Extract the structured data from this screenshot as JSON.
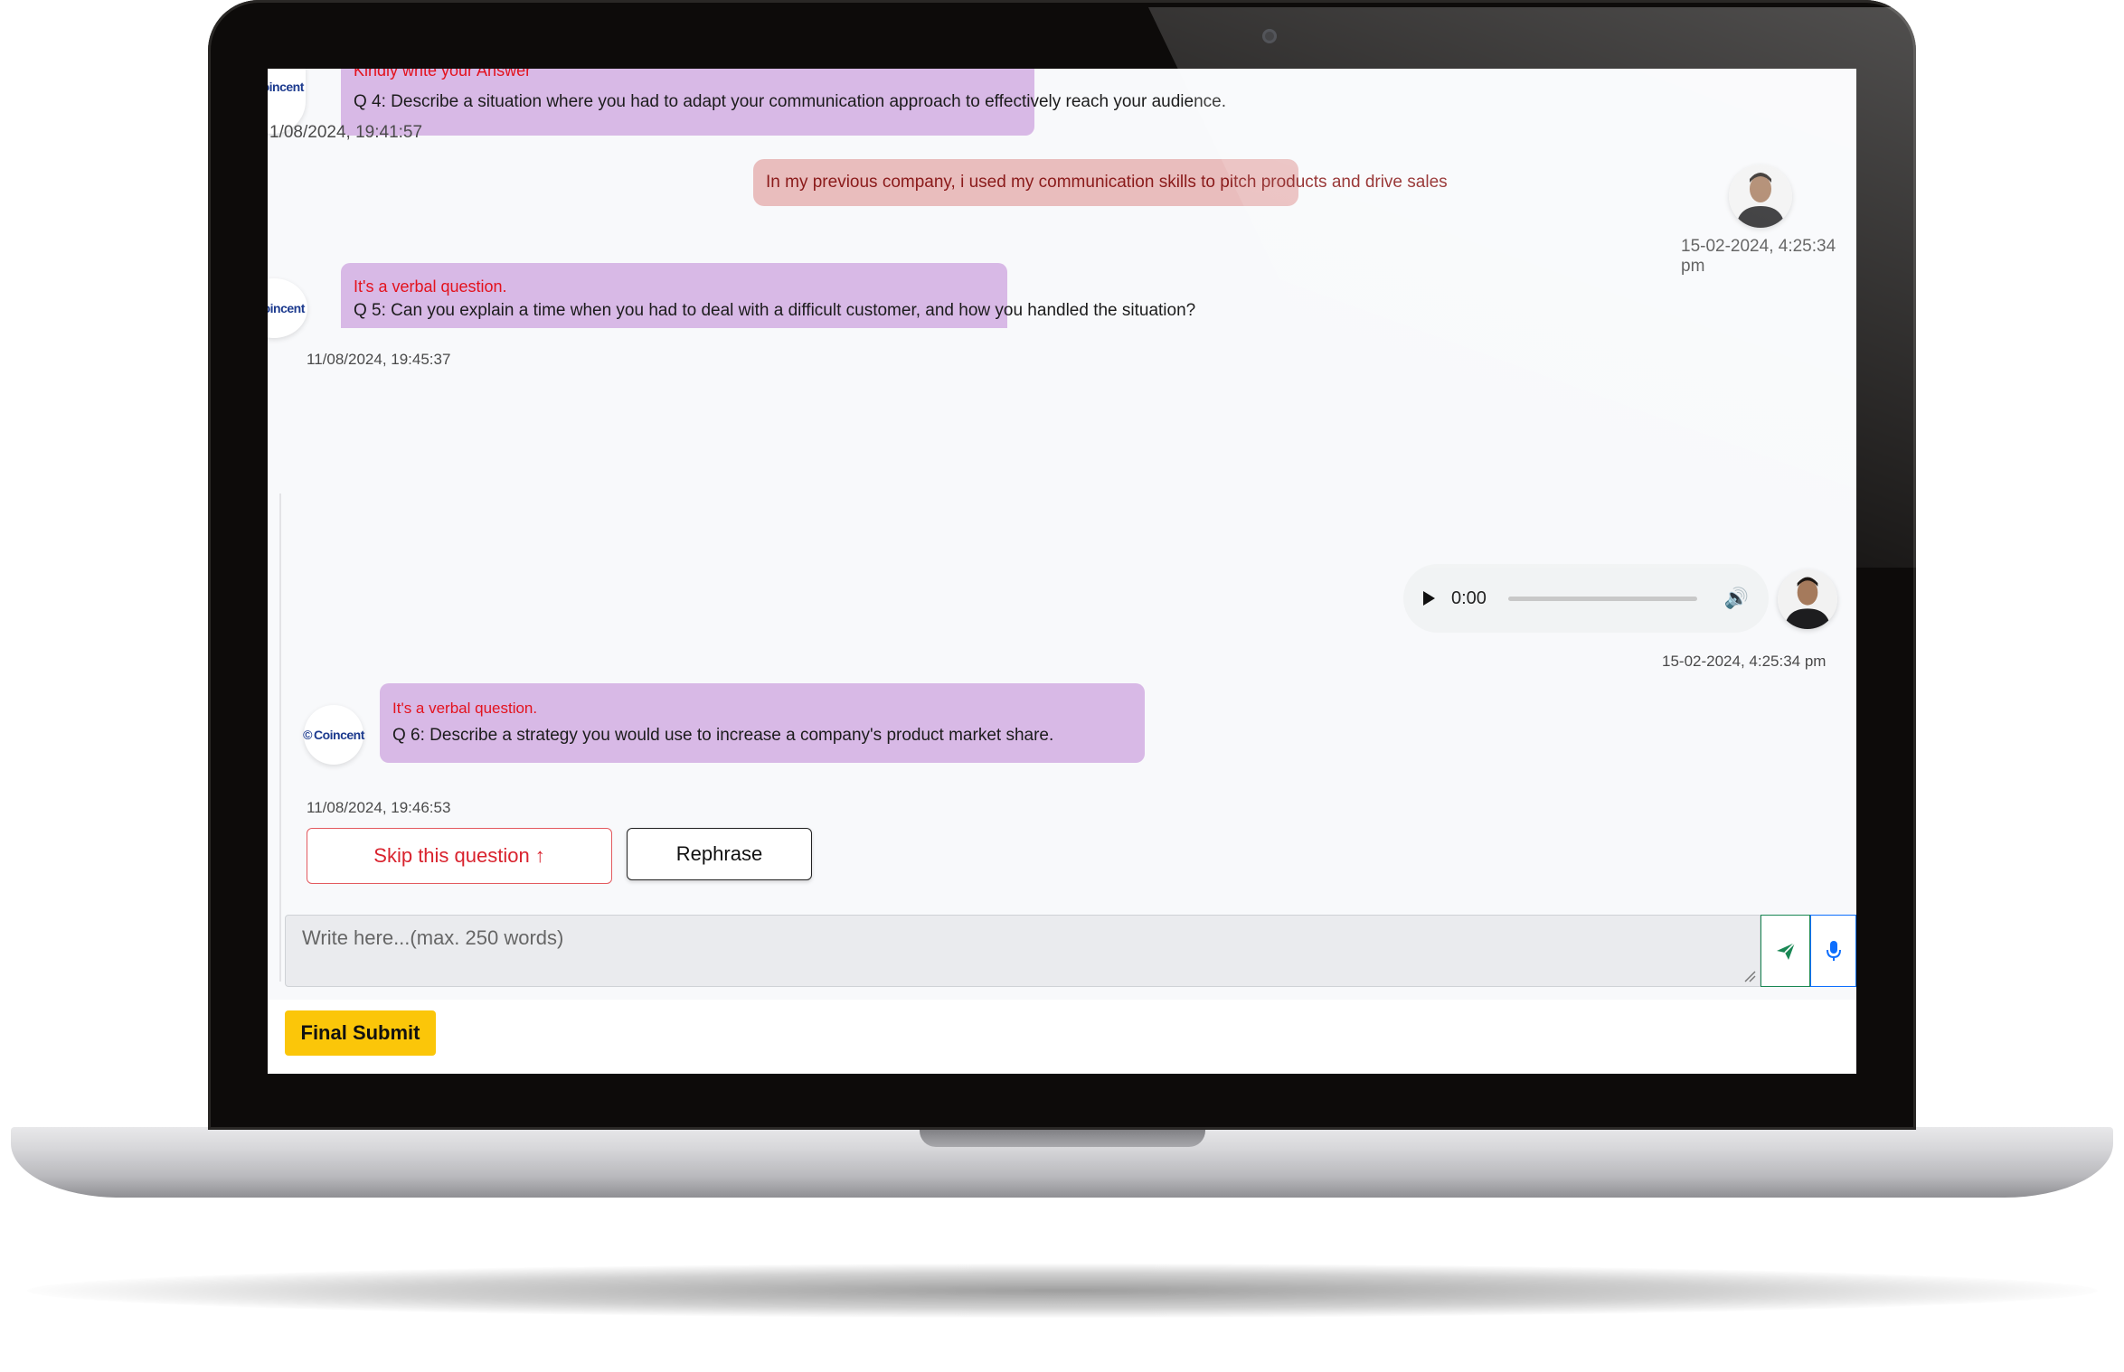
{
  "brand": {
    "logo_text": "Coincent"
  },
  "chat": {
    "q4": {
      "hint": "Kindly write your Answer",
      "text": "Q 4: Describe a situation where you had to adapt your communication approach to effectively reach your audience.",
      "timestamp": "1/08/2024, 19:41:57"
    },
    "a4": {
      "text": "In my previous company, i used my communication skills to pitch products and drive sales",
      "timestamp": "15-02-2024, 4:25:34 pm"
    },
    "q5": {
      "hint": "It's a verbal question.",
      "text": "Q 5: Can you explain a time when you had to deal with a difficult customer, and how you handled the situation?",
      "timestamp": "11/08/2024, 19:45:37"
    },
    "a5": {
      "audio_time": "0:00",
      "timestamp": "15-02-2024, 4:25:34 pm"
    },
    "q6": {
      "hint": "It's a verbal question.",
      "text": "Q 6: Describe a strategy you would use to increase a company's product market share.",
      "timestamp": "11/08/2024, 19:46:53"
    }
  },
  "actions": {
    "skip_label": "Skip this question",
    "skip_icon": "↑",
    "rephrase_label": "Rephrase"
  },
  "composer": {
    "placeholder": "Write here...(max. 250 words)",
    "send_icon": "send-icon",
    "mic_icon": "mic-icon"
  },
  "footer": {
    "final_submit_label": "Final Submit"
  },
  "colors": {
    "question_bubble": "#d8b9e6",
    "answer_bubble": "#e9bdbd",
    "hint_red": "#e3121d",
    "final_submit": "#fbc609"
  }
}
